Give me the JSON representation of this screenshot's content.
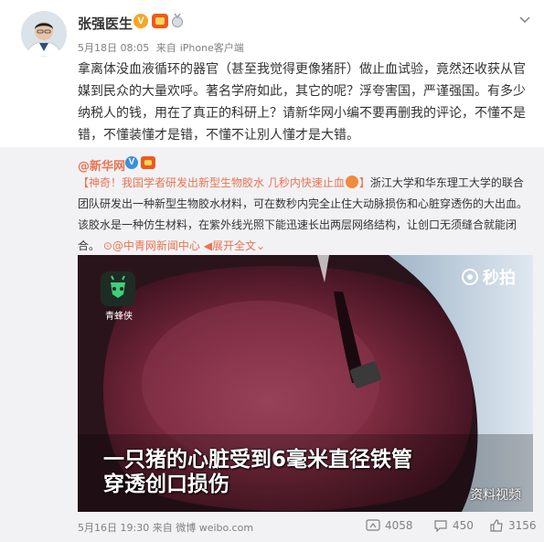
{
  "post": {
    "author": "张强医生",
    "time": "5月18日 08:05",
    "source_prefix": "来自",
    "source": "iPhone客户端",
    "text": "拿离体没血液循环的器官（甚至我觉得更像猪肝）做止血试验，竟然还收获从官媒到民众的大量欢呼。著名学府如此，其它的呢？浮夸害国，严谨强国。有多少纳税人的钱，用在了真正的科研上？请新华网小编不要再删我的评论，不懂不是错，不懂装懂才是错，不懂不让別人懂才是大错。"
  },
  "repost": {
    "author": "@新华网",
    "title_link": "【神奇！我国学者研发出新型生物胶水 几秒内快速止血",
    "title_end": "】",
    "body": "浙江大学和华东理工大学的联合团队研发出一种新型生物胶水材料，可在数秒内完全止住大动脉损伤和心脏穿透伤的大出血。该胶水是一种仿生材料，在紫外线光照下能迅速长出两层网络结构，让创口无须缝合就能闭合。",
    "source_link": "@中青网新闻中心",
    "expand": "展开全文",
    "video": {
      "app_logo_label": "青蜂侠",
      "miaopai": "秒拍",
      "caption_line1": "一只猪的心脏受到6毫米直径铁管",
      "caption_line2": "穿透创口损伤",
      "watermark": "资料视频"
    },
    "footer": {
      "time": "5月16日 19:30",
      "source_prefix": "来自",
      "source": "微博 weibo.com",
      "reposts": "4058",
      "comments": "450",
      "likes": "3156"
    }
  },
  "colors": {
    "link": "#eb7350",
    "meta": "#808080",
    "repost_bg": "#f2f2f5"
  }
}
